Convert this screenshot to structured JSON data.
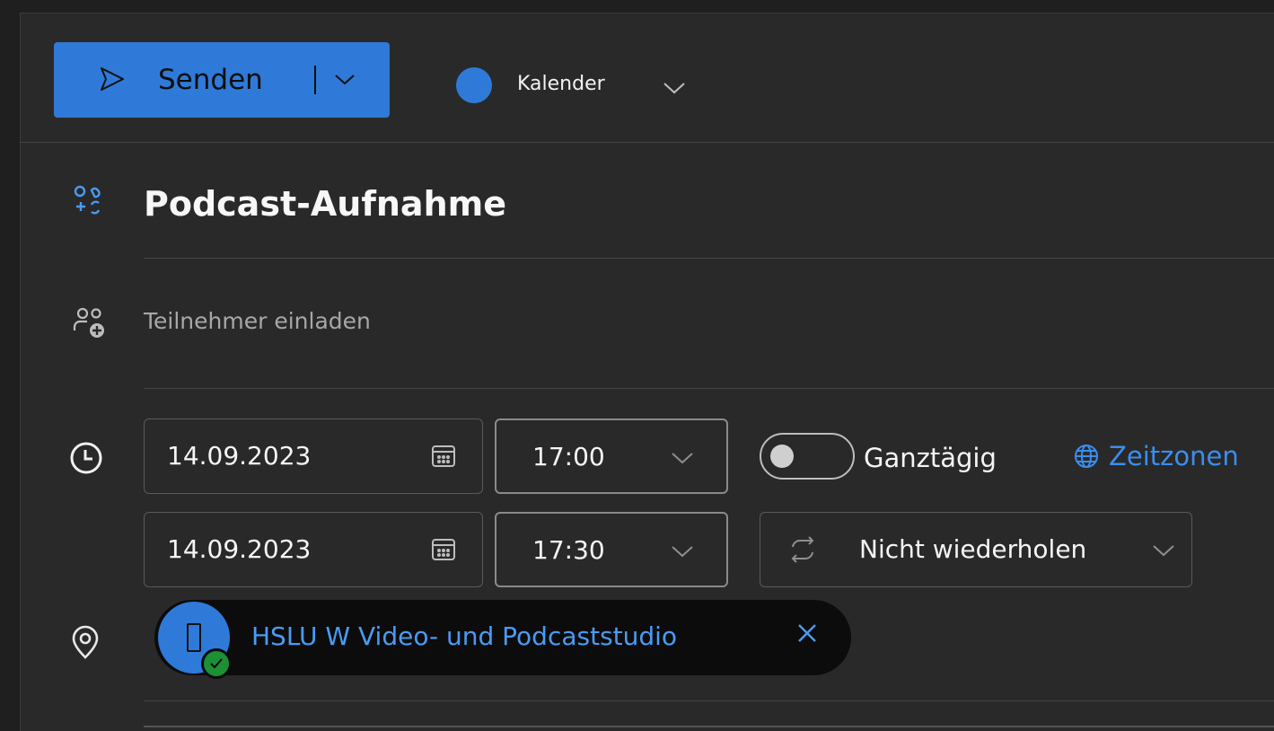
{
  "toolbar": {
    "send_label": "Senden",
    "calendar_label": "Kalender",
    "calendar_color": "#2f7ad8"
  },
  "event": {
    "title": "Podcast-Aufnahme",
    "attendees_placeholder": "Teilnehmer einladen",
    "start_date": "14.09.2023",
    "start_time": "17:00",
    "end_date": "14.09.2023",
    "end_time": "17:30",
    "all_day_label": "Ganztägig",
    "all_day_on": false,
    "timezones_label": "Zeitzonen",
    "repeat_label": "Nicht wiederholen",
    "location": {
      "name": "HSLU W Video- und Podcaststudio",
      "status": "available"
    }
  },
  "colors": {
    "accent": "#2f7ad8",
    "link": "#3a8ef0",
    "available": "#1d8f35"
  }
}
